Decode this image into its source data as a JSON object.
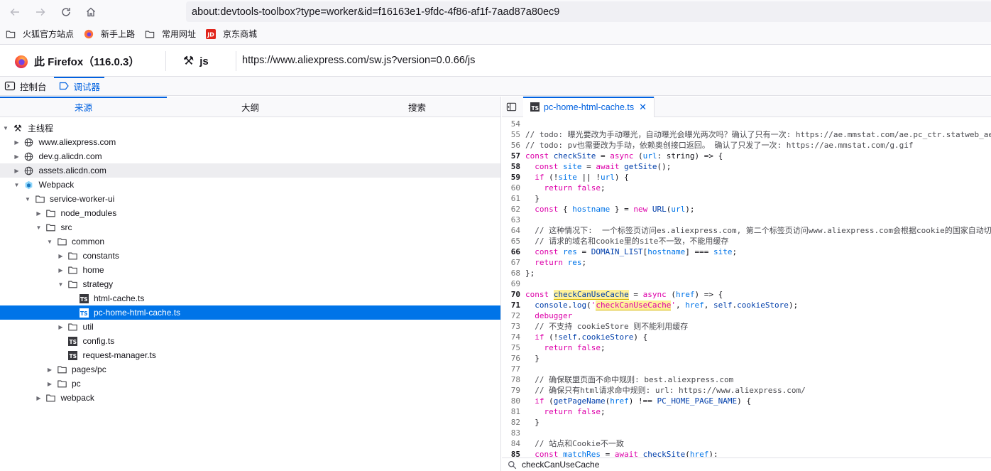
{
  "browser": {
    "url": "about:devtools-toolbox?type=worker&id=f16163e1-9fdc-4f86-af1f-7aad87a80ec9",
    "bookmarks": [
      {
        "label": "火狐官方站点",
        "icon": "folder-icon"
      },
      {
        "label": "新手上路",
        "icon": "firefox-icon"
      },
      {
        "label": "常用网址",
        "icon": "folder-icon"
      },
      {
        "label": "京东商城",
        "icon": "jd-icon"
      }
    ]
  },
  "toolbox": {
    "target": "此 Firefox（116.0.3）",
    "worker": "js",
    "worker_url": "https://www.aliexpress.com/sw.js?version=0.0.66/js"
  },
  "devtools_tabs": [
    {
      "label": "控制台",
      "icon": "console-icon"
    },
    {
      "label": "调试器",
      "icon": "debugger-icon",
      "selected": true
    }
  ],
  "sources": {
    "tabs": [
      "来源",
      "大纲",
      "搜索"
    ],
    "selected_tab": "来源",
    "tree": [
      {
        "label": "主线程",
        "depth": 0,
        "icon": "thread",
        "twisty": "open"
      },
      {
        "label": "www.aliexpress.com",
        "depth": 1,
        "icon": "globe",
        "twisty": "closed"
      },
      {
        "label": "dev.g.alicdn.com",
        "depth": 1,
        "icon": "globe",
        "twisty": "closed"
      },
      {
        "label": "assets.alicdn.com",
        "depth": 1,
        "icon": "globe",
        "twisty": "closed",
        "hover": true
      },
      {
        "label": "Webpack",
        "depth": 1,
        "icon": "webpack",
        "twisty": "open"
      },
      {
        "label": "service-worker-ui",
        "depth": 2,
        "icon": "folder",
        "twisty": "open"
      },
      {
        "label": "node_modules",
        "depth": 3,
        "icon": "folder",
        "twisty": "closed"
      },
      {
        "label": "src",
        "depth": 3,
        "icon": "folder",
        "twisty": "open"
      },
      {
        "label": "common",
        "depth": 4,
        "icon": "folder",
        "twisty": "open"
      },
      {
        "label": "constants",
        "depth": 5,
        "icon": "folder",
        "twisty": "closed"
      },
      {
        "label": "home",
        "depth": 5,
        "icon": "folder",
        "twisty": "closed"
      },
      {
        "label": "strategy",
        "depth": 5,
        "icon": "folder",
        "twisty": "open"
      },
      {
        "label": "html-cache.ts",
        "depth": 6,
        "icon": "ts",
        "twisty": "none"
      },
      {
        "label": "pc-home-html-cache.ts",
        "depth": 6,
        "icon": "ts",
        "twisty": "none",
        "selected": true
      },
      {
        "label": "util",
        "depth": 5,
        "icon": "folder",
        "twisty": "closed"
      },
      {
        "label": "config.ts",
        "depth": 5,
        "icon": "ts",
        "twisty": "none"
      },
      {
        "label": "request-manager.ts",
        "depth": 5,
        "icon": "ts",
        "twisty": "none"
      },
      {
        "label": "pages/pc",
        "depth": 4,
        "icon": "folder",
        "twisty": "closed"
      },
      {
        "label": "pc",
        "depth": 4,
        "icon": "folder",
        "twisty": "closed"
      },
      {
        "label": "webpack",
        "depth": 3,
        "icon": "folder",
        "twisty": "closed"
      }
    ]
  },
  "editor": {
    "tab_label": "pc-home-html-cache.ts",
    "search_query": "checkCanUseCache",
    "lines": [
      {
        "n": "54",
        "bold": false,
        "tokens": []
      },
      {
        "n": "55",
        "bold": false,
        "tokens": [
          [
            "c",
            "// todo: 曝光要改为手动曝光，自动曝光会曝光两次吗？确认了只有一次: https://ae.mmstat.com/ae.pc_ctr.statweb_ae"
          ]
        ]
      },
      {
        "n": "56",
        "bold": false,
        "tokens": [
          [
            "c",
            "// todo: pv也需要改为手动，依赖奥创接口返回。 确认了只发了一次: https://ae.mmstat.com/g.gif"
          ]
        ]
      },
      {
        "n": "57",
        "bold": true,
        "tokens": [
          [
            "k",
            "const "
          ],
          [
            "b",
            "checkSite"
          ],
          [
            "",
            " = "
          ],
          [
            "k",
            "async"
          ],
          [
            "",
            " ("
          ],
          [
            "p",
            "url"
          ],
          [
            "",
            ": string) => {"
          ]
        ]
      },
      {
        "n": "58",
        "bold": true,
        "tokens": [
          [
            "",
            "  "
          ],
          [
            "k",
            "const "
          ],
          [
            "p",
            "site"
          ],
          [
            "",
            " = "
          ],
          [
            "k",
            "await "
          ],
          [
            "b",
            "getSite"
          ],
          [
            "",
            "();"
          ]
        ]
      },
      {
        "n": "59",
        "bold": true,
        "tokens": [
          [
            "",
            "  "
          ],
          [
            "k",
            "if"
          ],
          [
            "",
            " (!"
          ],
          [
            "p",
            "site"
          ],
          [
            "",
            " || !"
          ],
          [
            "p",
            "url"
          ],
          [
            "",
            ") {"
          ]
        ]
      },
      {
        "n": "60",
        "bold": false,
        "tokens": [
          [
            "",
            "    "
          ],
          [
            "k",
            "return false"
          ],
          [
            "",
            ";"
          ]
        ]
      },
      {
        "n": "61",
        "bold": false,
        "tokens": [
          [
            "",
            "  }"
          ]
        ]
      },
      {
        "n": "62",
        "bold": false,
        "tokens": [
          [
            "",
            "  "
          ],
          [
            "k",
            "const"
          ],
          [
            "",
            " { "
          ],
          [
            "p",
            "hostname"
          ],
          [
            "",
            " } = "
          ],
          [
            "k",
            "new "
          ],
          [
            "b",
            "URL"
          ],
          [
            "",
            "("
          ],
          [
            "p",
            "url"
          ],
          [
            "",
            ");"
          ]
        ]
      },
      {
        "n": "63",
        "bold": false,
        "tokens": []
      },
      {
        "n": "64",
        "bold": false,
        "tokens": [
          [
            "c",
            "  // 这种情况下:  一个标签页访问es.aliexpress.com, 第二个标签页访问www.aliexpress.com会根据cookie的国家自动切换"
          ]
        ]
      },
      {
        "n": "65",
        "bold": false,
        "tokens": [
          [
            "c",
            "  // 请求的域名和cookie里的site不一致，不能用缓存"
          ]
        ]
      },
      {
        "n": "66",
        "bold": true,
        "tokens": [
          [
            "",
            "  "
          ],
          [
            "k",
            "const "
          ],
          [
            "p",
            "res"
          ],
          [
            "",
            " = "
          ],
          [
            "b",
            "DOMAIN_LIST"
          ],
          [
            "",
            "["
          ],
          [
            "p",
            "hostname"
          ],
          [
            "",
            "] === "
          ],
          [
            "p",
            "site"
          ],
          [
            "",
            ";"
          ]
        ]
      },
      {
        "n": "67",
        "bold": false,
        "tokens": [
          [
            "",
            "  "
          ],
          [
            "k",
            "return "
          ],
          [
            "p",
            "res"
          ],
          [
            "",
            ";"
          ]
        ]
      },
      {
        "n": "68",
        "bold": false,
        "tokens": [
          [
            "",
            "};"
          ]
        ]
      },
      {
        "n": "69",
        "bold": false,
        "tokens": []
      },
      {
        "n": "70",
        "bold": true,
        "tokens": [
          [
            "k",
            "const "
          ],
          [
            "b hl",
            "checkCanUseCache"
          ],
          [
            "",
            " = "
          ],
          [
            "k",
            "async"
          ],
          [
            "",
            " ("
          ],
          [
            "p",
            "href"
          ],
          [
            "",
            ") => {"
          ]
        ]
      },
      {
        "n": "71",
        "bold": true,
        "tokens": [
          [
            "",
            "  "
          ],
          [
            "b",
            "console"
          ],
          [
            "",
            "."
          ],
          [
            "b",
            "log"
          ],
          [
            "",
            "("
          ],
          [
            "s",
            "'"
          ],
          [
            "s hl",
            "checkCanUseCache"
          ],
          [
            "s",
            "'"
          ],
          [
            "",
            ", "
          ],
          [
            "p",
            "href"
          ],
          [
            "",
            ", "
          ],
          [
            "b",
            "self"
          ],
          [
            "",
            "."
          ],
          [
            "b",
            "cookieStore"
          ],
          [
            "",
            ");"
          ]
        ]
      },
      {
        "n": "72",
        "bold": false,
        "tokens": [
          [
            "",
            "  "
          ],
          [
            "k",
            "debugger"
          ]
        ]
      },
      {
        "n": "73",
        "bold": false,
        "tokens": [
          [
            "c",
            "  // 不支持 cookieStore 则不能利用缓存"
          ]
        ]
      },
      {
        "n": "74",
        "bold": false,
        "tokens": [
          [
            "",
            "  "
          ],
          [
            "k",
            "if"
          ],
          [
            "",
            " (!"
          ],
          [
            "b",
            "self"
          ],
          [
            "",
            "."
          ],
          [
            "b",
            "cookieStore"
          ],
          [
            "",
            ") {"
          ]
        ]
      },
      {
        "n": "75",
        "bold": false,
        "tokens": [
          [
            "",
            "    "
          ],
          [
            "k",
            "return false"
          ],
          [
            "",
            ";"
          ]
        ]
      },
      {
        "n": "76",
        "bold": false,
        "tokens": [
          [
            "",
            "  }"
          ]
        ]
      },
      {
        "n": "77",
        "bold": false,
        "tokens": []
      },
      {
        "n": "78",
        "bold": false,
        "tokens": [
          [
            "c",
            "  // 确保联盟页面不命中规则: best.aliexpress.com"
          ]
        ]
      },
      {
        "n": "79",
        "bold": false,
        "tokens": [
          [
            "c",
            "  // 确保只有html请求命中规则: url: https://www.aliexpress.com/"
          ]
        ]
      },
      {
        "n": "80",
        "bold": false,
        "tokens": [
          [
            "",
            "  "
          ],
          [
            "k",
            "if"
          ],
          [
            "",
            " ("
          ],
          [
            "b",
            "getPageName"
          ],
          [
            "",
            "("
          ],
          [
            "p",
            "href"
          ],
          [
            "",
            ") !== "
          ],
          [
            "b",
            "PC_HOME_PAGE_NAME"
          ],
          [
            "",
            ") {"
          ]
        ]
      },
      {
        "n": "81",
        "bold": false,
        "tokens": [
          [
            "",
            "    "
          ],
          [
            "k",
            "return false"
          ],
          [
            "",
            ";"
          ]
        ]
      },
      {
        "n": "82",
        "bold": false,
        "tokens": [
          [
            "",
            "  }"
          ]
        ]
      },
      {
        "n": "83",
        "bold": false,
        "tokens": []
      },
      {
        "n": "84",
        "bold": false,
        "tokens": [
          [
            "c",
            "  // 站点和Cookie不一致"
          ]
        ]
      },
      {
        "n": "85",
        "bold": true,
        "tokens": [
          [
            "",
            "  "
          ],
          [
            "k",
            "const "
          ],
          [
            "p",
            "matchRes"
          ],
          [
            "",
            " = "
          ],
          [
            "k",
            "await "
          ],
          [
            "b",
            "checkSite"
          ],
          [
            "",
            "("
          ],
          [
            "p",
            "href"
          ],
          [
            "",
            ");"
          ]
        ]
      }
    ]
  }
}
